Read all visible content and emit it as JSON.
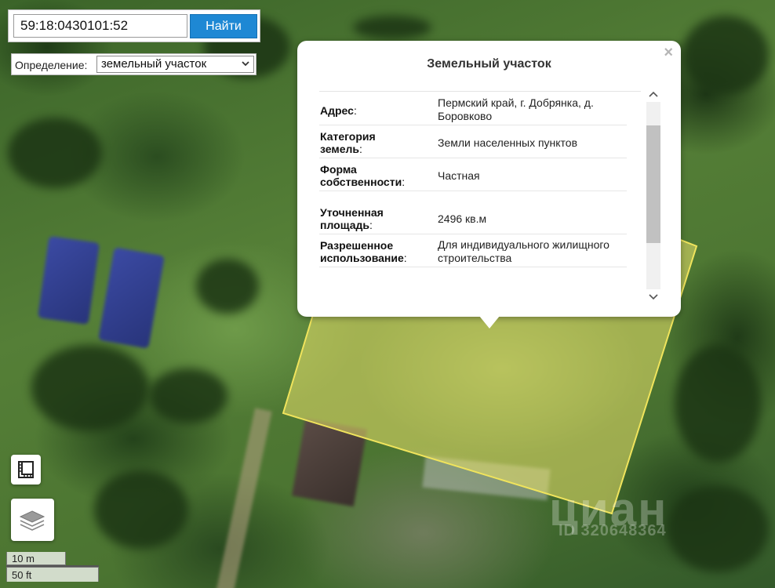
{
  "search": {
    "value": "59:18:0430101:52",
    "button_label": "Найти"
  },
  "definition": {
    "label": "Определение:",
    "selected": "земельный участок"
  },
  "popup": {
    "title": "Земельный участок",
    "close_glyph": "×",
    "rows": [
      {
        "label": "Адрес",
        "value": "Пермский край, г. Добрянка, д. Боровково"
      },
      {
        "label": "Категория земель",
        "value": "Земли населенных пунктов"
      },
      {
        "label": "Форма собственности",
        "value": "Частная"
      },
      {
        "label": "Уточненная площадь",
        "value": "2496 кв.м"
      },
      {
        "label": "Разрешенное использование",
        "value": "Для индивидуального жилищного строительства"
      }
    ],
    "label_suffix": ":"
  },
  "scale": {
    "metric": "10 m",
    "imperial": "50 ft"
  },
  "watermark": {
    "text": "циан",
    "id": "ID 320648364"
  },
  "colors": {
    "parcel_fill": "#e8e06a",
    "parcel_stroke": "#f0e45c",
    "search_button": "#1e88d4"
  },
  "icons": {
    "ruler": "ruler-icon",
    "layers": "layers-icon",
    "close": "close-icon",
    "dropdown": "chevron-down-icon"
  }
}
